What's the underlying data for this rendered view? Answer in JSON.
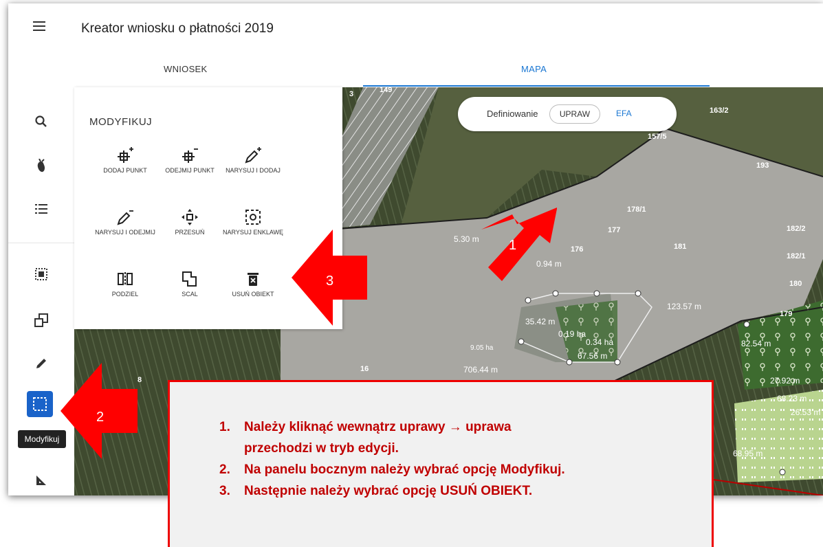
{
  "app": {
    "title": "Kreator wniosku o płatności 2019"
  },
  "tabs": [
    {
      "label": "WNIOSEK",
      "active": false
    },
    {
      "label": "MAPA",
      "active": true
    }
  ],
  "sidebar": {
    "tooltip": "Modyfikuj",
    "items": [
      {
        "icon": "search-icon"
      },
      {
        "icon": "crop-icon"
      },
      {
        "icon": "list-icon"
      },
      {
        "icon": "select-area-icon"
      },
      {
        "icon": "copy-layers-icon"
      },
      {
        "icon": "pencil-icon"
      },
      {
        "icon": "modify-icon",
        "active": true
      },
      {
        "icon": "measure-icon"
      }
    ]
  },
  "panel": {
    "title": "MODYFIKUJ",
    "tools": [
      {
        "label": "DODAJ PUNKT",
        "icon": "add-point-icon"
      },
      {
        "label": "ODEJMIJ PUNKT",
        "icon": "remove-point-icon"
      },
      {
        "label": "NARYSUJ I DODAJ",
        "icon": "draw-add-icon"
      },
      {
        "label": "NARYSUJ I ODEJMIJ",
        "icon": "draw-subtract-icon"
      },
      {
        "label": "PRZESUŃ",
        "icon": "move-icon"
      },
      {
        "label": "NARYSUJ ENKLAWĘ",
        "icon": "enclave-icon"
      },
      {
        "label": "PODZIEL",
        "icon": "split-icon"
      },
      {
        "label": "SCAL",
        "icon": "merge-icon"
      },
      {
        "label": "USUŃ OBIEKT",
        "icon": "delete-icon"
      }
    ]
  },
  "map_toggle": {
    "label": "Definiowanie",
    "options": [
      {
        "label": "UPRAW",
        "active": true
      },
      {
        "label": "EFA",
        "active": false
      }
    ]
  },
  "map": {
    "parcel_labels": [
      "149",
      "163/2",
      "157/5",
      "193",
      "178/1",
      "177",
      "176",
      "181",
      "182/1",
      "182/2",
      "180",
      "179",
      "16",
      "8",
      "3"
    ],
    "measure_labels": [
      "5.30 m",
      "0.94 m",
      "123.57 m",
      "35.42 m",
      "9.05 ha",
      "706.44 m",
      "82.54 m",
      "27.92 m",
      "68.23 m",
      "26.53 m",
      "68.95 m",
      "0.19 ha",
      "0.34 ha",
      "67.56 m"
    ]
  },
  "arrows": [
    "1",
    "2",
    "3"
  ],
  "arrow_color": "#ff0000",
  "callout": {
    "items": [
      {
        "num": "1.",
        "line1": "Należy kliknąć wewnątrz uprawy → uprawa",
        "line2": "przechodzi w tryb edycji."
      },
      {
        "num": "2.",
        "line1": "Na panelu bocznym należy wybrać opcję Modyfikuj."
      },
      {
        "num": "3.",
        "line1": "Następnie należy wybrać opcję USUŃ OBIEKT."
      }
    ]
  }
}
